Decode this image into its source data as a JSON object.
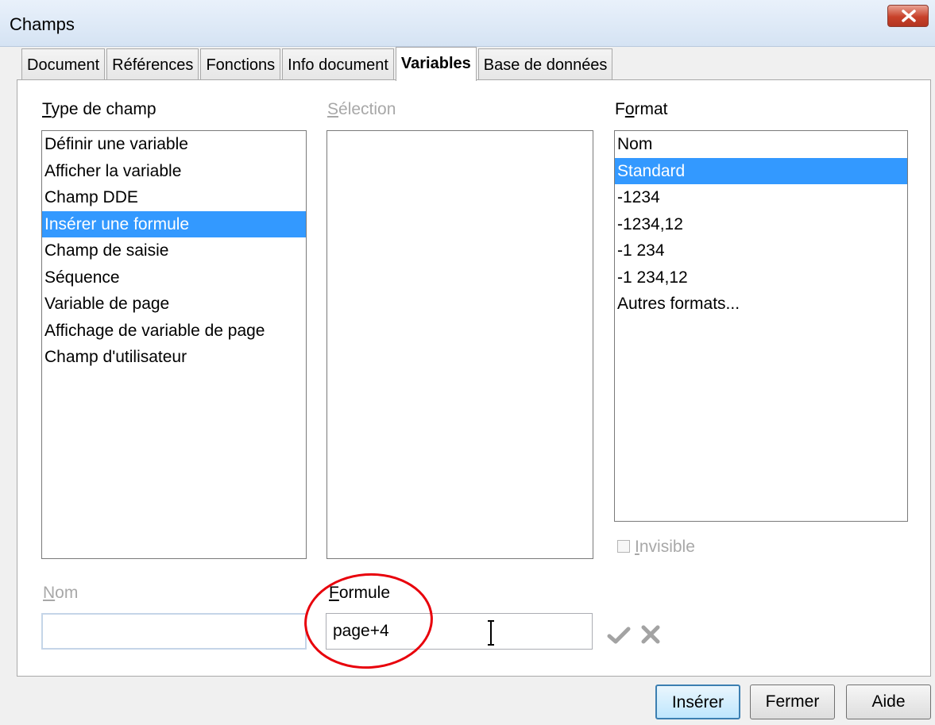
{
  "window": {
    "title": "Champs"
  },
  "tabs": [
    {
      "label": "Document"
    },
    {
      "label": "Références"
    },
    {
      "label": "Fonctions"
    },
    {
      "label": "Info document"
    },
    {
      "label": "Variables"
    },
    {
      "label": "Base de données"
    }
  ],
  "active_tab": "Variables",
  "type_de_champ": {
    "label_first": "T",
    "label_rest": "ype de champ",
    "items": [
      "Définir une variable",
      "Afficher la variable",
      "Champ DDE",
      "Insérer une formule",
      "Champ de saisie",
      "Séquence",
      "Variable de page",
      "Affichage de variable de page",
      "Champ d'utilisateur"
    ],
    "selected": "Insérer une formule"
  },
  "selection": {
    "label_first": "S",
    "label_rest": "élection",
    "items": []
  },
  "format": {
    "label_first": "F",
    "label_mid": "o",
    "label_rest": "rmat",
    "items": [
      "Nom",
      "Standard",
      "-1234",
      "-1234,12",
      "-1 234",
      "-1 234,12",
      "Autres formats..."
    ],
    "selected": "Standard"
  },
  "invisible": {
    "label_first": "I",
    "label_rest": "nvisible",
    "checked": false
  },
  "nom": {
    "label_first": "N",
    "label_rest": "om",
    "value": ""
  },
  "formule": {
    "label_first": "F",
    "label_rest": "ormule",
    "value": "page+4"
  },
  "buttons": {
    "insert": "Insérer",
    "close": "Fermer",
    "help": "Aide"
  },
  "colors": {
    "selection": "#3399ff",
    "highlight_circle": "#e8000b"
  }
}
